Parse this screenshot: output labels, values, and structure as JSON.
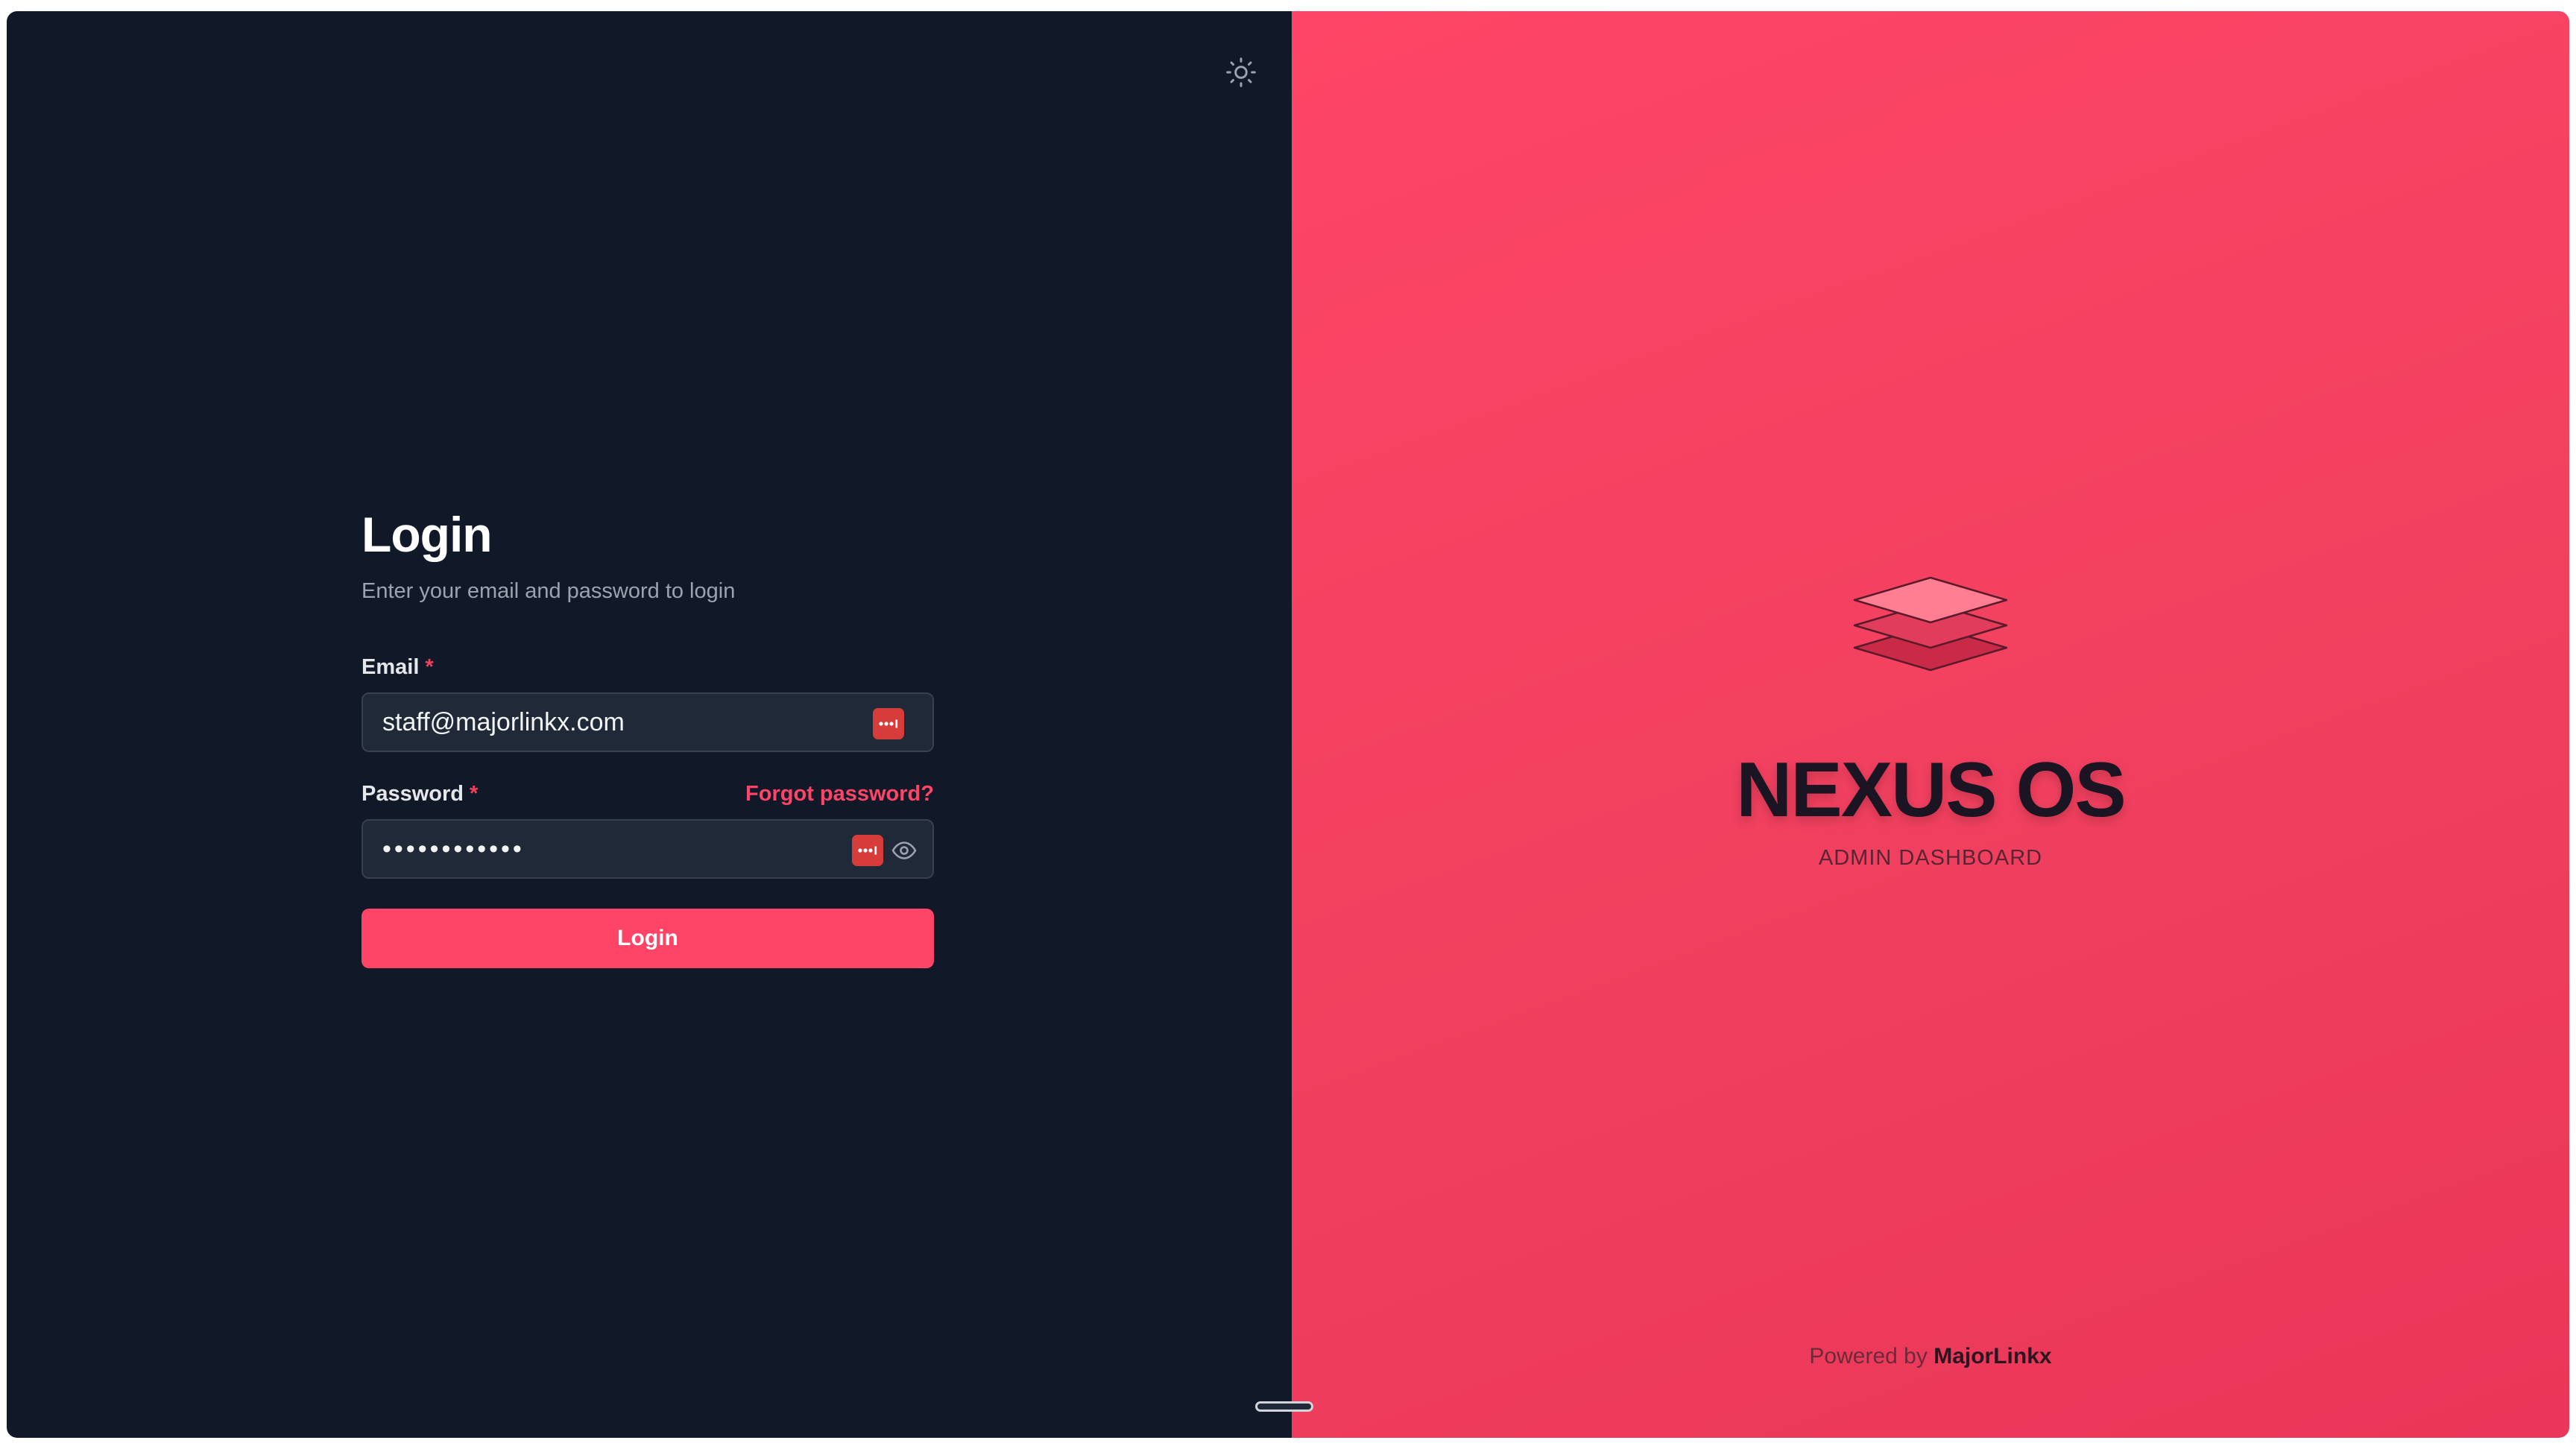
{
  "login": {
    "title": "Login",
    "subtitle": "Enter your email and password to login",
    "email_label": "Email",
    "required_marker": "*",
    "email_value": "staff@majorlinkx.com",
    "password_label": "Password",
    "forgot_password": "Forgot password?",
    "password_value": "••••••••••••",
    "submit_label": "Login"
  },
  "brand": {
    "name": "NEXUS OS",
    "tagline": "ADMIN DASHBOARD"
  },
  "footer": {
    "powered_by": "Powered by",
    "company": "MajorLinkx"
  },
  "icons": {
    "theme_toggle": "sun-icon",
    "password_manager": "password-manager-icon",
    "show_password": "eye-icon",
    "logo": "layers-logo-icon"
  },
  "colors": {
    "left_panel_bg": "#111827",
    "accent": "#fe4567",
    "brand_panel_bg": "#f1405f",
    "brand_text": "#1a1423"
  }
}
